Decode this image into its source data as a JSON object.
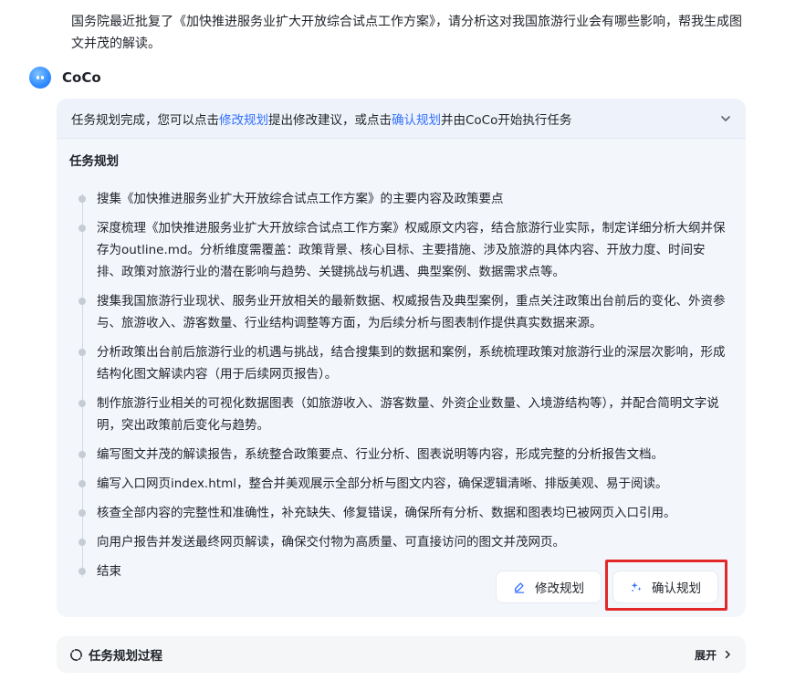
{
  "user_message": "国务院最近批复了《加快推进服务业扩大开放综合试点工作方案》，请分析这对我国旅游行业会有哪些影响，帮我生成图文并茂的解读。",
  "bot": {
    "name": "CoCo"
  },
  "notice": {
    "prefix": "任务规划完成，您可以点击",
    "link_modify": "修改规划",
    "middle": "提出修改建议，或点击",
    "link_confirm": "确认规划",
    "suffix": "并由CoCo开始执行任务"
  },
  "plan": {
    "title": "任务规划",
    "steps": [
      "搜集《加快推进服务业扩大开放综合试点工作方案》的主要内容及政策要点",
      "深度梳理《加快推进服务业扩大开放综合试点工作方案》权威原文内容，结合旅游行业实际，制定详细分析大纲并保存为outline.md。分析维度需覆盖：政策背景、核心目标、主要措施、涉及旅游的具体内容、开放力度、时间安排、政策对旅游行业的潜在影响与趋势、关键挑战与机遇、典型案例、数据需求点等。",
      "搜集我国旅游行业现状、服务业开放相关的最新数据、权威报告及典型案例，重点关注政策出台前后的变化、外资参与、旅游收入、游客数量、行业结构调整等方面，为后续分析与图表制作提供真实数据来源。",
      "分析政策出台前后旅游行业的机遇与挑战，结合搜集到的数据和案例，系统梳理政策对旅游行业的深层次影响，形成结构化图文解读内容（用于后续网页报告）。",
      "制作旅游行业相关的可视化数据图表（如旅游收入、游客数量、外资企业数量、入境游结构等），并配合简明文字说明，突出政策前后变化与趋势。",
      "编写图文并茂的解读报告，系统整合政策要点、行业分析、图表说明等内容，形成完整的分析报告文档。",
      "编写入口网页index.html，整合并美观展示全部分析与图文内容，确保逻辑清晰、排版美观、易于阅读。",
      "核查全部内容的完整性和准确性，补充缺失、修复错误，确保所有分析、数据和图表均已被网页入口引用。",
      "向用户报告并发送最终网页解读，确保交付物为高质量、可直接访问的图文并茂网页。",
      "结束"
    ]
  },
  "actions": {
    "modify_label": "修改规划",
    "confirm_label": "确认规划"
  },
  "process": {
    "title": "任务规划过程",
    "expand_label": "展开"
  },
  "colors": {
    "link": "#3370ff",
    "highlight": "#e3282a",
    "card_bg": "#f3f6fb"
  }
}
